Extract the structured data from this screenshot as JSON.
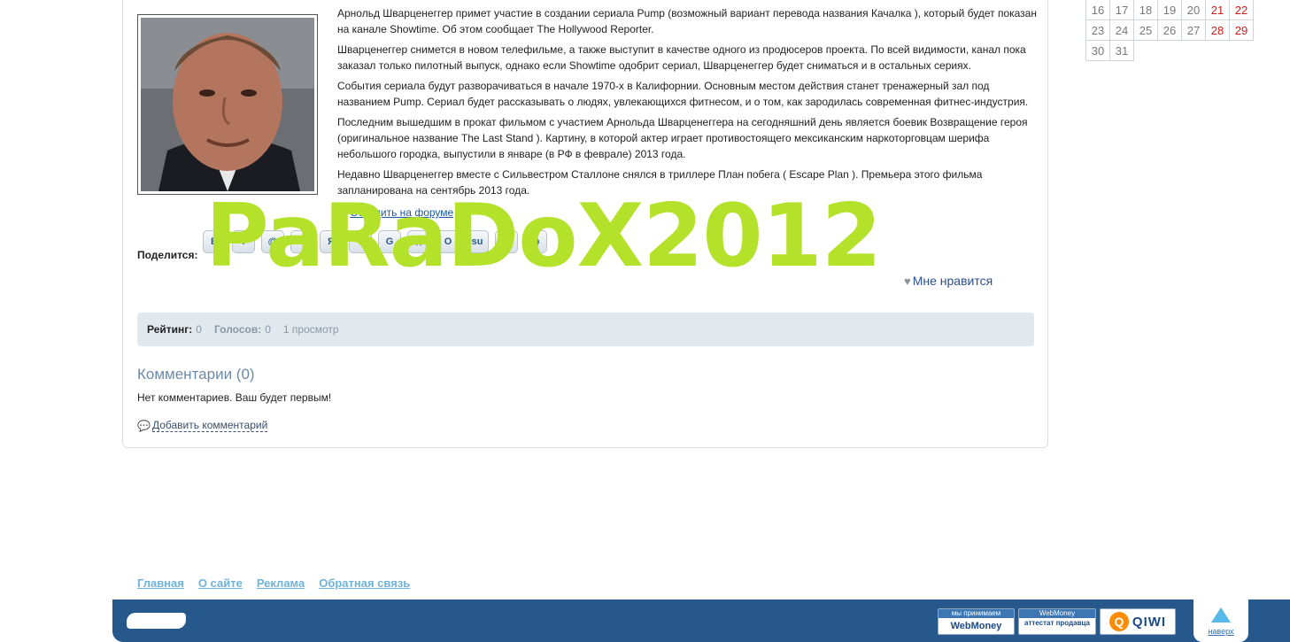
{
  "article": {
    "paragraphs": [
      "Арнольд Шварценеггер примет участие в создании сериала Pump (возможный вариант перевода названия Качалка ), который будет показан на канале Showtime. Об этом сообщает The Hollywood Reporter.",
      "Шварценеггер снимется в новом телефильме, а также выступит в качестве одного из продюсеров проекта. По всей видимости, канал пока заказал только пилотный выпуск, однако если Showtime одобрит сериал, Шварценеггер будет сниматься и в остальных сериях.",
      "События сериала будут разворачиваться в начале 1970-х в Калифорнии. Основным местом действия станет тренажерный зал под названием Pump. Сериал будет рассказывать о людях, увлекающихся фитнесом, и о том, как зародилась современная фитнес-индустрия.",
      "Последним вышедшим в прокат фильмом с участием Арнольда Шварценеггера на сегодняшний день является боевик Возвращение героя (оригинальное название The Last Stand ). Картину, в которой актер играет противостоящего мексиканским наркоторговцам шерифа небольшого городка, выпустили в январе (в РФ в феврале) 2013 года.",
      "Недавно Шварценеггер вместе с Сильвестром Сталлоне снялся в триллере План побега ( Escape Plan ). Премьера этого фильма запланирована на сентябрь 2013 года."
    ],
    "discuss_link": "Обсудить на форуме"
  },
  "share": {
    "label": "Поделится:",
    "icons": [
      {
        "name": "vk-share-icon",
        "glyph": "В"
      },
      {
        "name": "facebook-share-icon",
        "glyph": "f"
      },
      {
        "name": "mail-share-icon",
        "glyph": "@"
      },
      {
        "name": "twitter-share-icon",
        "glyph": "t"
      },
      {
        "name": "yandex-share-icon",
        "glyph": "Я"
      },
      {
        "name": "livejournal-share-icon",
        "glyph": "✎"
      },
      {
        "name": "google-share-icon",
        "glyph": "G"
      },
      {
        "name": "bookmark-share-icon",
        "glyph": "★"
      },
      {
        "name": "odnoklassniki-share-icon",
        "glyph": "О"
      },
      {
        "name": "stumbleupon-share-icon",
        "glyph": "su"
      },
      {
        "name": "stats-share-icon",
        "glyph": "▥"
      },
      {
        "name": "misc-share-icon",
        "glyph": "⚙"
      }
    ]
  },
  "watermark": "PaRaDoX2012",
  "like_label": "Мне нравится",
  "rating": {
    "rating_label": "Рейтинг:",
    "rating_value": "0",
    "votes_label": "Голосов:",
    "votes_value": "0",
    "views": "1 просмотр"
  },
  "comments": {
    "title": "Комментарии (0)",
    "empty_text": "Нет комментариев. Ваш будет первым!",
    "add_link": "Добавить комментарий"
  },
  "calendar": {
    "rows": [
      [
        {
          "d": "16",
          "we": false
        },
        {
          "d": "17",
          "we": false
        },
        {
          "d": "18",
          "we": false
        },
        {
          "d": "19",
          "we": false
        },
        {
          "d": "20",
          "we": false
        },
        {
          "d": "21",
          "we": true
        },
        {
          "d": "22",
          "we": true
        }
      ],
      [
        {
          "d": "23",
          "we": false
        },
        {
          "d": "24",
          "we": false
        },
        {
          "d": "25",
          "we": false
        },
        {
          "d": "26",
          "we": false
        },
        {
          "d": "27",
          "we": false
        },
        {
          "d": "28",
          "we": true
        },
        {
          "d": "29",
          "we": true
        }
      ],
      [
        {
          "d": "30",
          "we": false
        },
        {
          "d": "31",
          "we": false
        }
      ]
    ]
  },
  "footer": {
    "links": [
      "Главная",
      "О сайте",
      "Реклама",
      "Обратная связь"
    ],
    "webmoney_accept_top": "мы принимаем",
    "webmoney_accept_bottom": "WebMoney",
    "webmoney_attest_top": "WebMoney",
    "webmoney_attest_bottom": "аттестат продавца",
    "qiwi": "QIWI",
    "to_top": "наверх"
  },
  "colors": {
    "watermark": "#b4e22a",
    "footer_bar": "#26588c",
    "link": "#1a5aa6",
    "weekend": "#d11b1b"
  }
}
